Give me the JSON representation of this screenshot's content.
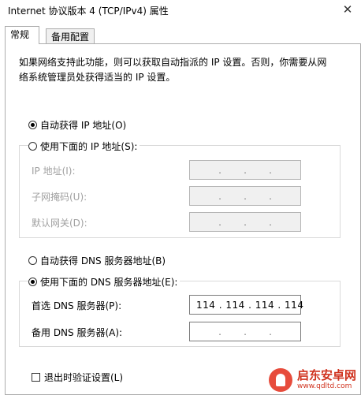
{
  "window": {
    "title": "Internet 协议版本 4 (TCP/IPv4) 属性",
    "close_glyph": "✕"
  },
  "tabs": [
    {
      "label": "常规",
      "active": true
    },
    {
      "label": "备用配置",
      "active": false
    }
  ],
  "description": "如果网络支持此功能，则可以获取自动指派的 IP 设置。否则，你需要从网络系统管理员处获得适当的 IP 设置。",
  "ip_section": {
    "auto_label": "自动获得 IP 地址(O)",
    "auto_selected": true,
    "manual_label": "使用下面的 IP 地址(S):",
    "manual_selected": false,
    "fields": [
      {
        "label": "IP 地址(I):",
        "value": ""
      },
      {
        "label": "子网掩码(U):",
        "value": ""
      },
      {
        "label": "默认网关(D):",
        "value": ""
      }
    ]
  },
  "dns_section": {
    "auto_label": "自动获得 DNS 服务器地址(B)",
    "auto_selected": false,
    "manual_label": "使用下面的 DNS 服务器地址(E):",
    "manual_selected": true,
    "fields": [
      {
        "label": "首选 DNS 服务器(P):",
        "value": "114 . 114 . 114 . 114"
      },
      {
        "label": "备用 DNS 服务器(A):",
        "value": ""
      }
    ]
  },
  "validate_label": "退出时验证设置(L)",
  "validate_checked": false,
  "watermark": {
    "name": "启东安卓网",
    "url": "www.qdltd.com"
  },
  "colors": {
    "watermark": "#d0331f",
    "disabled_text": "#a0a0a0"
  }
}
